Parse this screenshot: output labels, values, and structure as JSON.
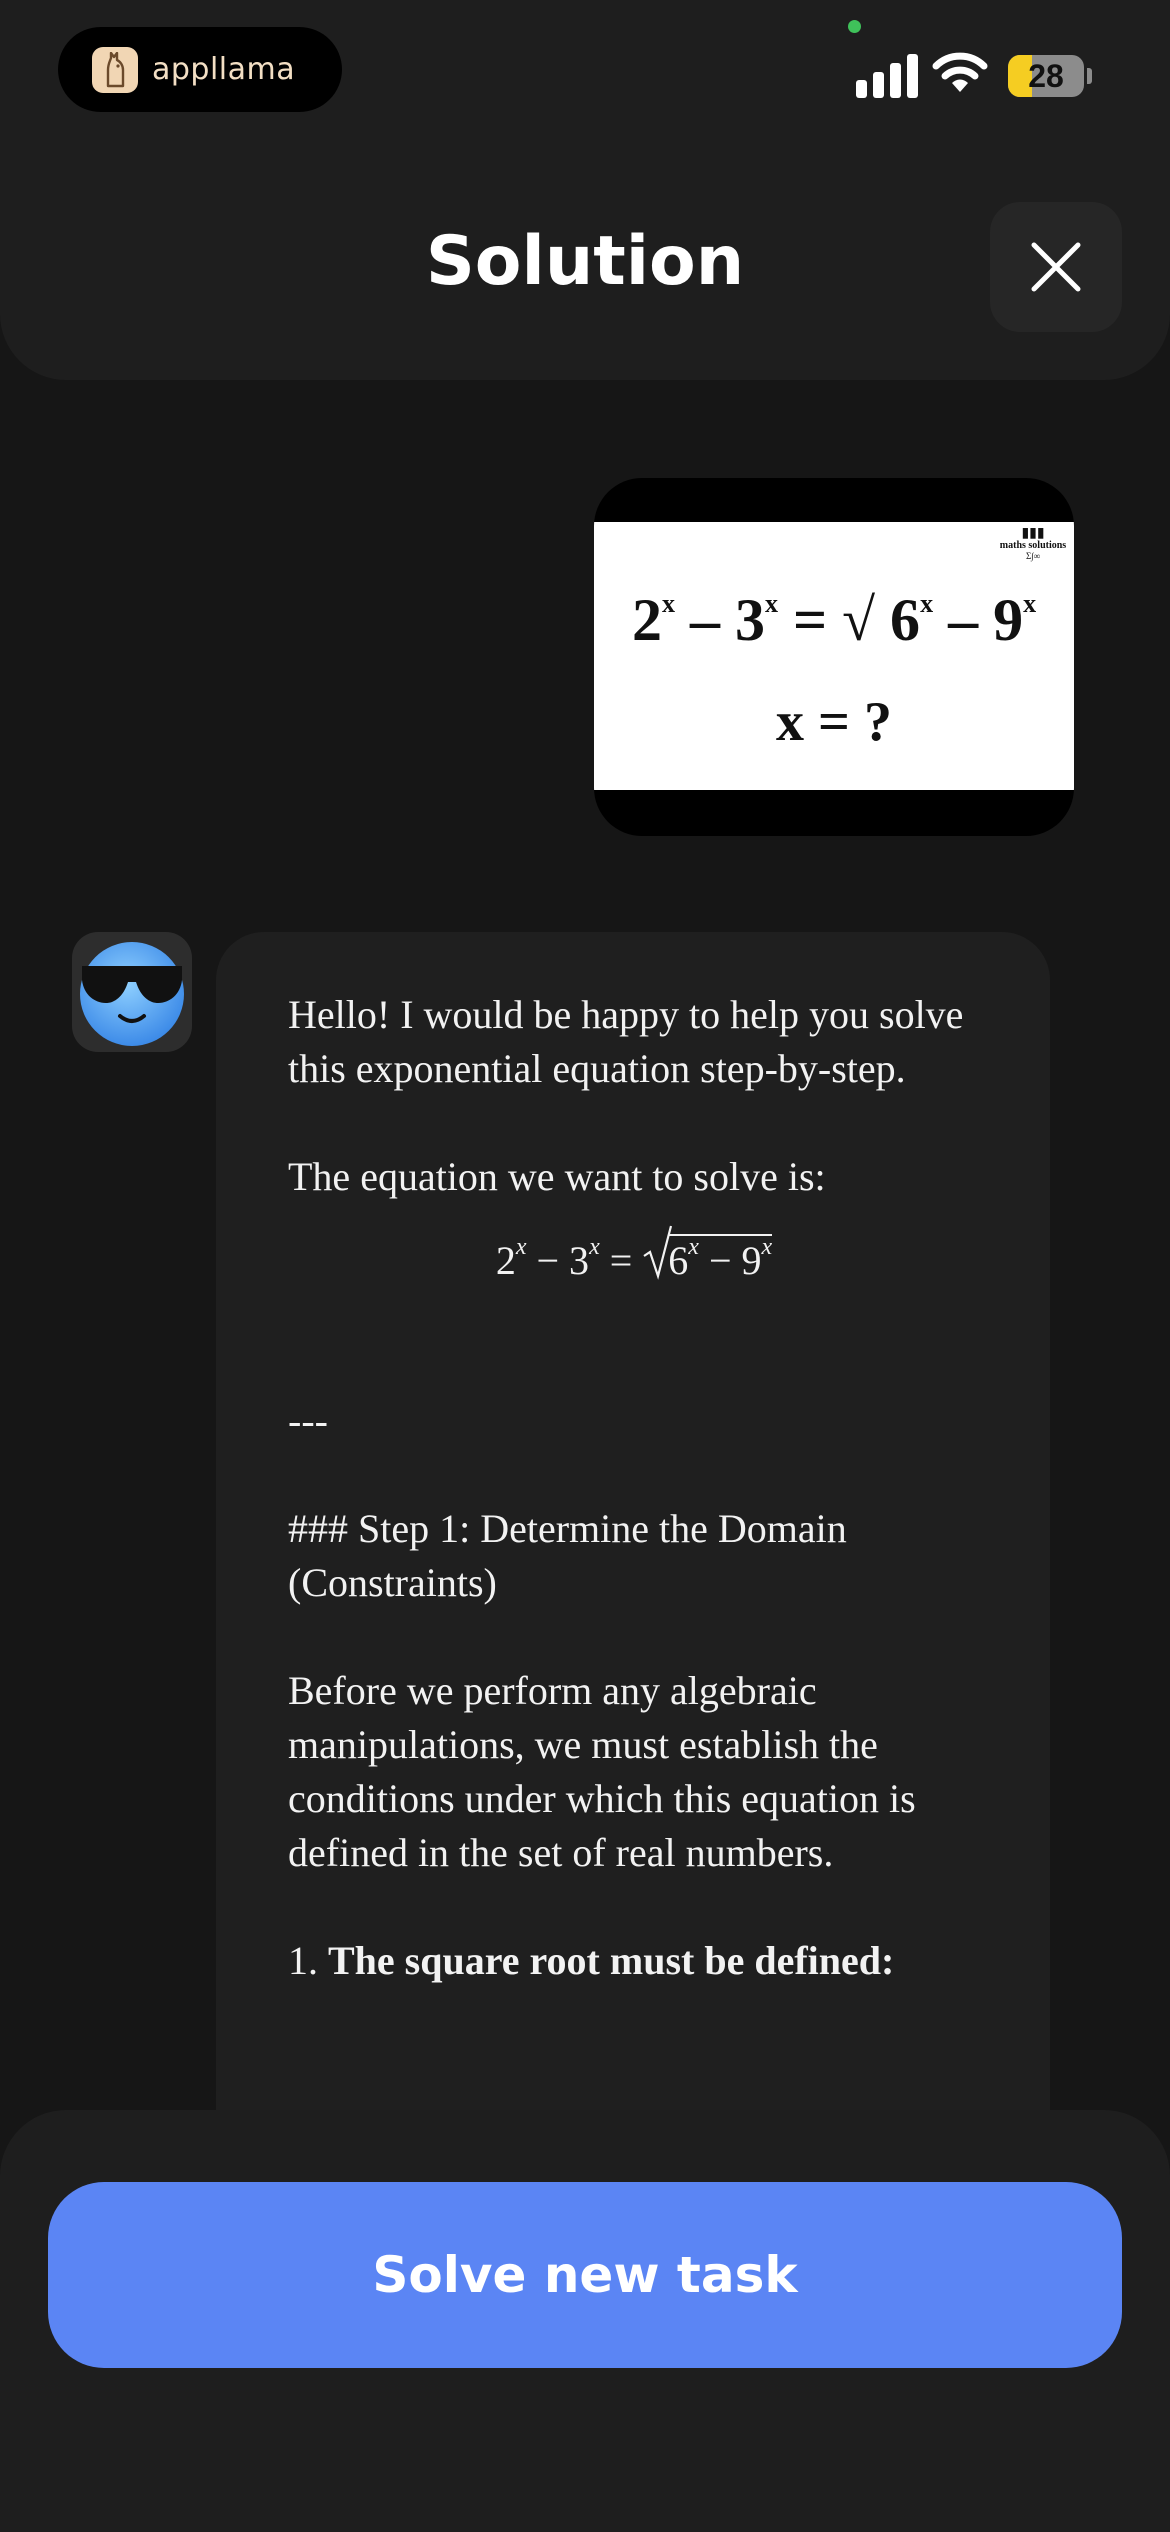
{
  "status_bar": {
    "app_name": "appllama",
    "battery_level": "28",
    "battery_fraction": 0.28
  },
  "header": {
    "title": "Solution"
  },
  "task_image": {
    "brand": "maths solutions",
    "equation_lhs": "2",
    "equation_exp": "x",
    "equation_text": "2ˣ – 3ˣ = √6ˣ – 9ˣ",
    "question": "x = ?"
  },
  "answer": {
    "intro": "Hello! I would be happy to help you solve this exponential equation step-by-step.",
    "equation_intro": "The equation we want to solve is:",
    "separator": "---",
    "step1_heading": "### Step 1: Determine the Domain (Constraints)",
    "step1_text": "Before we perform any algebraic manipulations, we must establish the conditions under which this equation is defined in the set of real numbers.",
    "step1_item_number": "1.",
    "step1_item_bold": "The square root must be defined:"
  },
  "footer": {
    "solve_button_label": "Solve new task"
  },
  "colors": {
    "background": "#161616",
    "panel": "#1e1e1e",
    "bubble": "#1f1f1f",
    "accent_button": "#5b85f4",
    "battery_fill": "#f5cd22",
    "camera_dot": "#3fc15a"
  },
  "icons": {
    "app_logo": "llama-icon",
    "close": "close-icon",
    "avatar": "sunglasses-emoji-icon",
    "signal": "cellular-signal-icon",
    "wifi": "wifi-icon",
    "battery": "battery-icon"
  }
}
